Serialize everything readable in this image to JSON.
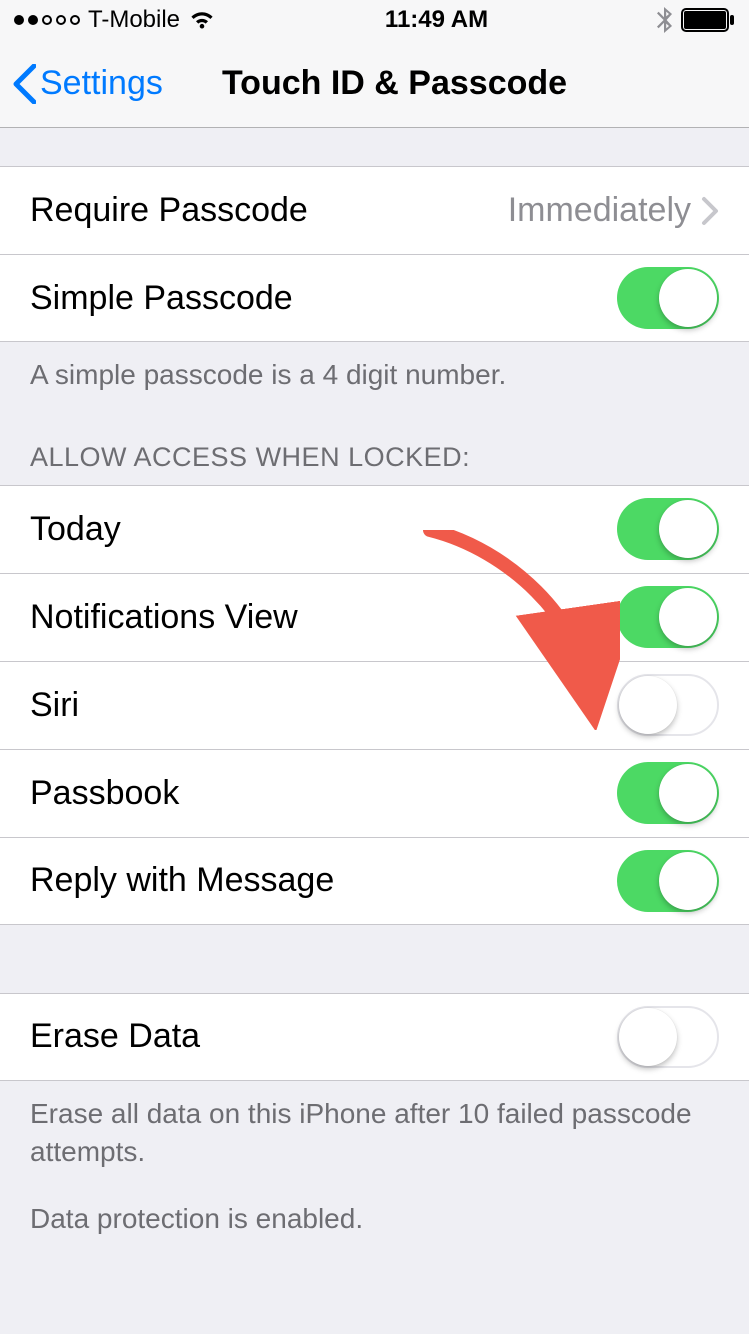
{
  "status": {
    "carrier": "T-Mobile",
    "time": "11:49 AM"
  },
  "nav": {
    "back_label": "Settings",
    "title": "Touch ID & Passcode"
  },
  "group1": {
    "require_passcode_label": "Require Passcode",
    "require_passcode_value": "Immediately",
    "simple_passcode_label": "Simple Passcode",
    "simple_passcode_on": true,
    "footer": "A simple passcode is a 4 digit number."
  },
  "group2": {
    "header": "ALLOW ACCESS WHEN LOCKED:",
    "items": [
      {
        "label": "Today",
        "on": true
      },
      {
        "label": "Notifications View",
        "on": true
      },
      {
        "label": "Siri",
        "on": false
      },
      {
        "label": "Passbook",
        "on": true
      },
      {
        "label": "Reply with Message",
        "on": true
      }
    ]
  },
  "group3": {
    "erase_label": "Erase Data",
    "erase_on": false,
    "footer1": "Erase all data on this iPhone after 10 failed passcode attempts.",
    "footer2": "Data protection is enabled."
  }
}
